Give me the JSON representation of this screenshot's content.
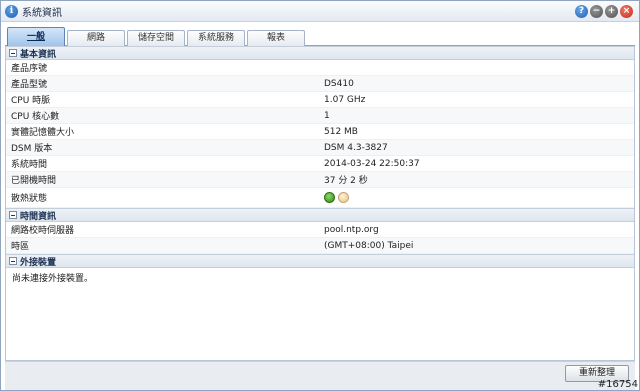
{
  "window": {
    "title": "系統資訊"
  },
  "tabs": [
    {
      "label": "一般"
    },
    {
      "label": "網路"
    },
    {
      "label": "儲存空間"
    },
    {
      "label": "系統服務"
    },
    {
      "label": "報表"
    }
  ],
  "sections": {
    "basic": {
      "title": "基本資訊",
      "rows": [
        {
          "label": "產品序號",
          "value": ""
        },
        {
          "label": "產品型號",
          "value": "DS410"
        },
        {
          "label": "CPU 時脈",
          "value": "1.07 GHz"
        },
        {
          "label": "CPU 核心數",
          "value": "1"
        },
        {
          "label": "實體記憶體大小",
          "value": "512 MB"
        },
        {
          "label": "DSM 版本",
          "value": "DSM 4.3-3827"
        },
        {
          "label": "系統時間",
          "value": "2014-03-24 22:50:37"
        },
        {
          "label": "已開機時間",
          "value": "37 分 2 秒"
        },
        {
          "label": "散熱狀態",
          "value": ""
        }
      ]
    },
    "time": {
      "title": "時間資訊",
      "rows": [
        {
          "label": "網路校時伺服器",
          "value": "pool.ntp.org"
        },
        {
          "label": "時區",
          "value": "(GMT+08:00) Taipei"
        }
      ]
    },
    "external": {
      "title": "外接裝置",
      "note": "尚未連接外接裝置。"
    }
  },
  "footer": {
    "refresh_label": "重新整理"
  },
  "watermark": "#16754",
  "colors": {
    "fan_ok": "#2e8a12",
    "fan_idle": "#e7c28e",
    "close": "#c22a17"
  }
}
